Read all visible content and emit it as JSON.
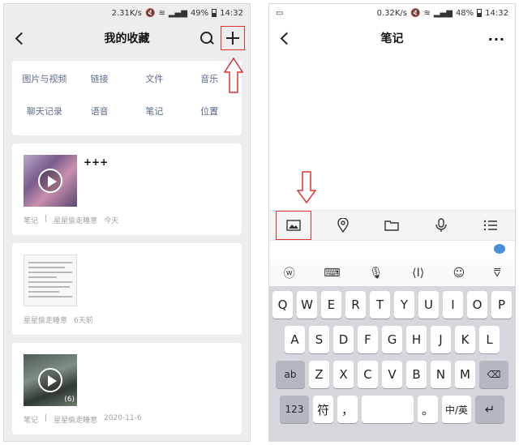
{
  "left": {
    "status": {
      "speed": "2.31K/s",
      "battery": "49%",
      "time": "14:32"
    },
    "nav": {
      "title": "我的收藏"
    },
    "categories": [
      "图片与视频",
      "链接",
      "文件",
      "音乐",
      "聊天记录",
      "语音",
      "笔记",
      "位置"
    ],
    "favorites": [
      {
        "title": "+++",
        "meta": [
          "笔记",
          "|",
          "星星偷走睡意",
          "今天"
        ],
        "thumb_type": "video"
      },
      {
        "title": "",
        "meta": [
          "星星偷走睡意",
          "6天前"
        ],
        "thumb_type": "document"
      },
      {
        "title": "",
        "meta": [
          "笔记",
          "|",
          "星星偷走睡意",
          "2020-11-6"
        ],
        "thumb_type": "video",
        "badge": "(6)"
      }
    ]
  },
  "right": {
    "status": {
      "speed": "0.32K/s",
      "battery": "48%",
      "time": "14:32"
    },
    "nav": {
      "title": "笔记",
      "more": "···"
    },
    "toolbar_icons": [
      "image-icon",
      "location-icon",
      "folder-icon",
      "microphone-icon",
      "list-icon"
    ],
    "keyboard_top": [
      "ⓦ",
      "⌨",
      "🎙",
      "⟨I⟩",
      "☺",
      "⩢"
    ],
    "keyboard": {
      "row1": [
        "Q",
        "W",
        "E",
        "R",
        "T",
        "Y",
        "U",
        "I",
        "O",
        "P"
      ],
      "row2": [
        "A",
        "S",
        "D",
        "F",
        "G",
        "H",
        "J",
        "K",
        "L"
      ],
      "row3": [
        "ab",
        "Z",
        "X",
        "C",
        "V",
        "B",
        "N",
        "M",
        "⌫"
      ],
      "row4": [
        "123",
        "符",
        "，",
        "",
        "。",
        "中/英",
        "↵"
      ]
    }
  },
  "colors": {
    "highlight": "#e0322f",
    "link": "#5b6b8c"
  }
}
